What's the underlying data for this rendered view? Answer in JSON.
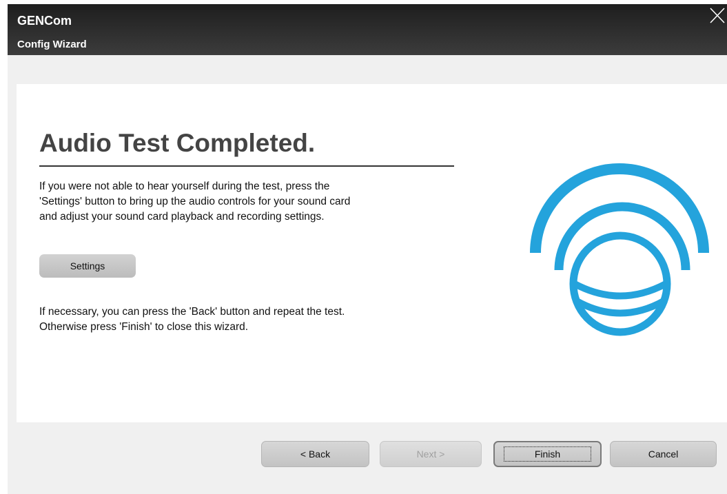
{
  "window": {
    "app_title": "GENCom",
    "wizard_title": "Config Wizard"
  },
  "content": {
    "heading": "Audio Test Completed.",
    "paragraph1": [
      "If you were not able to hear yourself during the test, press the",
      "'Settings' button to bring up the audio controls for your sound card",
      "and adjust your sound card playback and recording settings."
    ],
    "settings_label": "Settings",
    "paragraph2": [
      "If necessary, you can press the 'Back' button and repeat the test.",
      "Otherwise press 'Finish' to close this wizard."
    ]
  },
  "footer": {
    "back_label": "< Back",
    "next_label": "Next >",
    "finish_label": "Finish",
    "cancel_label": "Cancel"
  },
  "colors": {
    "logo": "#24a3dc",
    "titlebar": "#2a2a2a"
  },
  "icons": {
    "close": "close-icon",
    "logo": "gencom-logo-icon"
  }
}
